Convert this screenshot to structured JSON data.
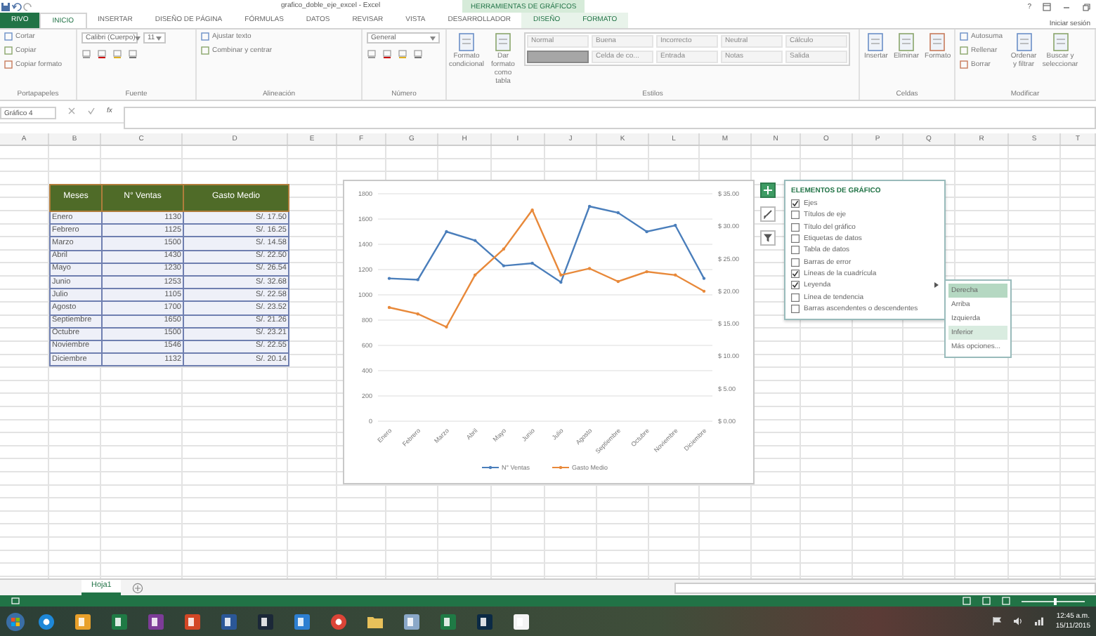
{
  "window": {
    "title": "grafico_doble_eje_excel - Excel",
    "help": "?",
    "sign_in": "Iniciar sesión"
  },
  "contextual_group": "HERRAMIENTAS DE GRÁFICOS",
  "ribbon_tabs": [
    {
      "label": "RIVO",
      "kind": "file",
      "selected": false
    },
    {
      "label": "INICIO",
      "kind": "normal",
      "selected": true
    },
    {
      "label": "INSERTAR",
      "kind": "normal",
      "selected": false
    },
    {
      "label": "DISEÑO DE PÁGINA",
      "kind": "normal",
      "selected": false
    },
    {
      "label": "FÓRMULAS",
      "kind": "normal",
      "selected": false
    },
    {
      "label": "DATOS",
      "kind": "normal",
      "selected": false
    },
    {
      "label": "REVISAR",
      "kind": "normal",
      "selected": false
    },
    {
      "label": "VISTA",
      "kind": "normal",
      "selected": false
    },
    {
      "label": "DESARROLLADOR",
      "kind": "normal",
      "selected": false
    },
    {
      "label": "DISEÑO",
      "kind": "contextual",
      "selected": false
    },
    {
      "label": "FORMATO",
      "kind": "contextual",
      "selected": false
    }
  ],
  "ribbon_groups": [
    {
      "label": "Portapapeles",
      "items": [
        "Cortar",
        "Copiar",
        "Copiar formato"
      ]
    },
    {
      "label": "Fuente",
      "fields": [
        "Calibri (Cuerpo)",
        "11"
      ]
    },
    {
      "label": "Alineación",
      "items": [
        "Ajustar texto",
        "Combinar y centrar"
      ]
    },
    {
      "label": "Número",
      "fields": [
        "General"
      ]
    },
    {
      "label": "Estilos",
      "buttons": [
        "Formato condicional",
        "Dar formato como tabla"
      ],
      "gallery": [
        {
          "kind": "style",
          "label": "Normal",
          "selected": false
        },
        {
          "kind": "style",
          "label": "Buena",
          "selected": false
        },
        {
          "kind": "style",
          "label": "Incorrecto",
          "selected": false
        },
        {
          "kind": "style",
          "label": "Neutral",
          "selected": false
        },
        {
          "kind": "style",
          "label": "Cálculo",
          "selected": false
        },
        {
          "kind": "swatch",
          "selected": true
        },
        {
          "kind": "style",
          "label": "Celda de co...",
          "selected": false
        },
        {
          "kind": "style",
          "label": "Entrada",
          "selected": false
        },
        {
          "kind": "style",
          "label": "Notas",
          "selected": false
        },
        {
          "kind": "style",
          "label": "Salida",
          "selected": false
        }
      ]
    },
    {
      "label": "Celdas",
      "buttons": [
        "Insertar",
        "Eliminar",
        "Formato"
      ]
    },
    {
      "label": "Modificar",
      "items": [
        "Autosuma",
        "Rellenar",
        "Borrar"
      ],
      "buttons": [
        "Ordenar y filtrar",
        "Buscar y seleccionar"
      ]
    }
  ],
  "formula_bar": {
    "name_box": "Gráfico 4",
    "fx": "fx"
  },
  "columns": [
    "A",
    "B",
    "C",
    "D",
    "E",
    "F",
    "G",
    "H",
    "I",
    "J",
    "K",
    "L",
    "M",
    "N",
    "O",
    "P",
    "Q",
    "R",
    "S",
    "T"
  ],
  "table": {
    "columns": [
      "Meses",
      "N° Ventas",
      "Gasto Medio"
    ],
    "rows": [
      [
        "Enero",
        "1130",
        "S/. 17.50"
      ],
      [
        "Febrero",
        "1125",
        "S/. 16.25"
      ],
      [
        "Marzo",
        "1500",
        "S/. 14.58"
      ],
      [
        "Abril",
        "1430",
        "S/. 22.50"
      ],
      [
        "Mayo",
        "1230",
        "S/. 26.54"
      ],
      [
        "Junio",
        "1253",
        "S/. 32.68"
      ],
      [
        "Julio",
        "1105",
        "S/. 22.58"
      ],
      [
        "Agosto",
        "1700",
        "S/. 23.52"
      ],
      [
        "Septiembre",
        "1650",
        "S/. 21.26"
      ],
      [
        "Octubre",
        "1500",
        "S/. 23.21"
      ],
      [
        "Noviembre",
        "1546",
        "S/. 22.55"
      ],
      [
        "Diciembre",
        "1132",
        "S/. 20.14"
      ]
    ]
  },
  "chart": {
    "chart_data": {
      "type": "line",
      "categories": [
        "Enero",
        "Febrero",
        "Marzo",
        "Abril",
        "Mayo",
        "Junio",
        "Julio",
        "Agosto",
        "Septiembre",
        "Octubre",
        "Noviembre",
        "Diciembre"
      ],
      "series": [
        {
          "name": "N° Ventas",
          "color": "#4a7ebb",
          "values": [
            1130,
            1120,
            1500,
            1430,
            1230,
            1250,
            1100,
            1700,
            1650,
            1500,
            1550,
            1130
          ]
        },
        {
          "name": "Gasto Medio",
          "color": "#e8893a",
          "axis": "y2",
          "values": [
            17.5,
            16.5,
            14.5,
            22.5,
            26.5,
            32.5,
            22.5,
            23.5,
            21.5,
            23,
            22.5,
            20
          ]
        }
      ],
      "ylim": [
        0,
        1800
      ],
      "yticks": [
        0,
        200,
        400,
        600,
        800,
        1000,
        1200,
        1400,
        1600,
        1800
      ],
      "grid": true,
      "legend": "bottom",
      "y2lim": [
        0,
        35
      ],
      "y2ticks": [
        {
          "value": 0,
          "label": "$ 0.00"
        },
        {
          "value": 5,
          "label": "$ 5.00"
        },
        {
          "value": 10,
          "label": "$ 10.00"
        },
        {
          "value": 15,
          "label": "$ 15.00"
        },
        {
          "value": 20,
          "label": "$ 20.00"
        },
        {
          "value": 25,
          "label": "$ 25.00"
        },
        {
          "value": 30,
          "label": "$ 30.00"
        },
        {
          "value": 35,
          "label": "$ 35.00"
        }
      ]
    }
  },
  "chart_elements": {
    "title": "ELEMENTOS DE GRÁFICO",
    "items": [
      {
        "label": "Ejes",
        "checked": true,
        "has_submenu": false
      },
      {
        "label": "Títulos de eje",
        "checked": false,
        "has_submenu": false
      },
      {
        "label": "Título del gráfico",
        "checked": false,
        "has_submenu": false
      },
      {
        "label": "Etiquetas de datos",
        "checked": false,
        "has_submenu": false
      },
      {
        "label": "Tabla de datos",
        "checked": false,
        "has_submenu": false
      },
      {
        "label": "Barras de error",
        "checked": false,
        "has_submenu": false
      },
      {
        "label": "Líneas de la cuadrícula",
        "checked": true,
        "has_submenu": false
      },
      {
        "label": "Leyenda",
        "checked": true,
        "has_submenu": true
      },
      {
        "label": "Línea de tendencia",
        "checked": false,
        "has_submenu": false
      },
      {
        "label": "Barras ascendentes o descendentes",
        "checked": false,
        "has_submenu": false
      }
    ]
  },
  "legend_submenu": {
    "items": [
      {
        "label": "Derecha",
        "selected": true,
        "hovered": false
      },
      {
        "label": "Arriba",
        "selected": false,
        "hovered": false
      },
      {
        "label": "Izquierda",
        "selected": false,
        "hovered": false
      },
      {
        "label": "Inferior",
        "selected": false,
        "hovered": true
      },
      {
        "label": "Más opciones...",
        "selected": false,
        "hovered": false
      }
    ]
  },
  "sheet_tabs": [
    {
      "label": "Hoja1",
      "selected": true
    }
  ],
  "status_bar": {
    "zoom_slider": {
      "level": 0.5
    }
  },
  "taskbar": {
    "clock": {
      "time": "12:45 a.m.",
      "date": "15/11/2015"
    }
  }
}
